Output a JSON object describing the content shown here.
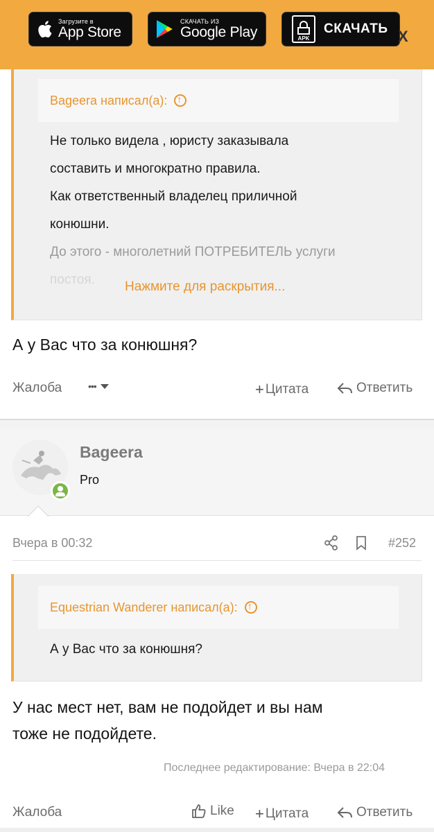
{
  "banner": {
    "appstore": {
      "small": "Загрузите в",
      "big": "App Store"
    },
    "googleplay": {
      "small": "СКАЧАТЬ ИЗ",
      "big": "Google Play"
    },
    "apk": {
      "badge": "APK",
      "label": "СКАЧАТЬ"
    },
    "close": "X"
  },
  "quote1": {
    "author": "Bageera написал(а):",
    "lines": [
      "Не только видела , юристу заказывала",
      "составить и многократно правила.",
      "Как ответственный владелец приличной",
      "конюшни.",
      "До этого - многолетний ПОТРЕБИТЕЛЬ услуги",
      "постоя."
    ],
    "expand": "Нажмите для раскрытия..."
  },
  "post1": {
    "text": "А у Вас что за конюшня?",
    "actions": {
      "report": "Жалоба",
      "more": "•••",
      "quote": "Цитата",
      "reply": "Ответить"
    }
  },
  "post2": {
    "username": "Bageera",
    "role": "Pro",
    "date": "Вчера в 00:32",
    "number": "#252",
    "quote": {
      "author": "Equestrian Wanderer написал(а):",
      "line": "А у Вас что за конюшня?"
    },
    "text_lines": [
      "У нас мест нет, вам не подойдет и вы нам",
      "тоже не подойдете."
    ],
    "edited": "Последнее редактирование: Вчера в 22:04",
    "actions": {
      "report": "Жалоба",
      "like": "Like",
      "quote": "Цитата",
      "reply": "Ответить"
    }
  },
  "colors": {
    "accent": "#f2a93f",
    "quote_author": "#e8952e",
    "online": "#7ab648"
  }
}
